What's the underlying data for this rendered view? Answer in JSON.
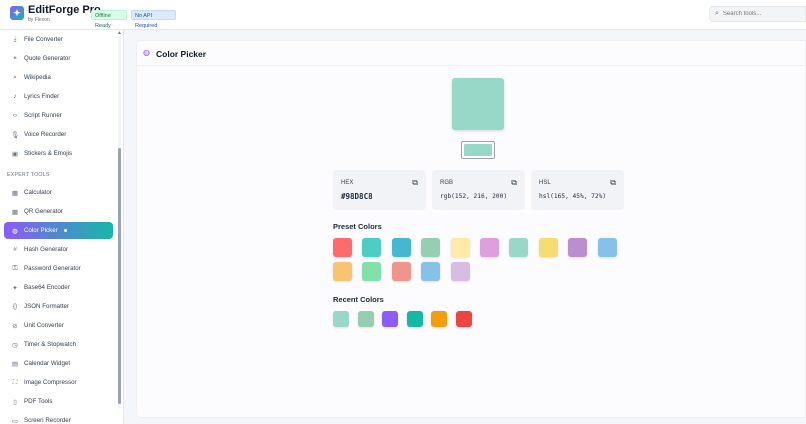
{
  "header": {
    "app_name": "EditForge Pro",
    "app_sub": "by Flexon",
    "badge_offline": "Offline Ready",
    "badge_api": "No API Required",
    "search_placeholder": "Search tools..."
  },
  "sidebar": {
    "items_top": [
      {
        "label": "File Converter",
        "icon": "download-icon",
        "glyph": "⤓"
      },
      {
        "label": "Quote Generator",
        "icon": "quote-icon",
        "glyph": "❝"
      },
      {
        "label": "Wikipedia",
        "icon": "search-icon",
        "glyph": "⌕"
      },
      {
        "label": "Lyrics Finder",
        "icon": "music-icon",
        "glyph": "♪"
      },
      {
        "label": "Script Runner",
        "icon": "code-icon",
        "glyph": "‹›"
      },
      {
        "label": "Voice Recorder",
        "icon": "mic-icon",
        "glyph": "🎙"
      },
      {
        "label": "Stickers & Emojis",
        "icon": "sticker-icon",
        "glyph": "▣"
      }
    ],
    "section_expert": "EXPERT TOOLS",
    "items_expert": [
      {
        "label": "Calculator",
        "icon": "calculator-icon",
        "glyph": "▦"
      },
      {
        "label": "QR Generator",
        "icon": "qr-icon",
        "glyph": "▩"
      },
      {
        "label": "Color Picker",
        "icon": "palette-icon",
        "glyph": "◍",
        "active": true
      },
      {
        "label": "Hash Generator",
        "icon": "hash-icon",
        "glyph": "#"
      },
      {
        "label": "Password Generator",
        "icon": "key-icon",
        "glyph": "⚿"
      },
      {
        "label": "Base64 Encoder",
        "icon": "sparkle-icon",
        "glyph": "✦"
      },
      {
        "label": "JSON Formatter",
        "icon": "braces-icon",
        "glyph": "{}"
      },
      {
        "label": "Unit Converter",
        "icon": "ruler-icon",
        "glyph": "⊘"
      },
      {
        "label": "Timer & Stopwatch",
        "icon": "clock-icon",
        "glyph": "◷"
      },
      {
        "label": "Calendar Widget",
        "icon": "calendar-icon",
        "glyph": "▤"
      },
      {
        "label": "Image Compressor",
        "icon": "compress-icon",
        "glyph": "⛶"
      },
      {
        "label": "PDF Tools",
        "icon": "file-icon",
        "glyph": "▯"
      },
      {
        "label": "Screen Recorder",
        "icon": "monitor-icon",
        "glyph": "▭"
      }
    ]
  },
  "main": {
    "title": "Color Picker",
    "current_color": "#98D8C8",
    "hex_label": "HEX",
    "hex_value": "#98D8C8",
    "rgb_label": "RGB",
    "rgb_value": "rgb(152, 216, 200)",
    "hsl_label": "HSL",
    "hsl_value": "hsl(165, 45%, 72%)",
    "preset_title": "Preset Colors",
    "preset_colors": [
      "#FF6B6B",
      "#4ECDC4",
      "#45B7D1",
      "#96CEB4",
      "#FFEAA7",
      "#DDA0DD",
      "#98D8C8",
      "#F7DC6F",
      "#BB8FCE",
      "#85C1E9",
      "#F8C471",
      "#82E0AA",
      "#F1948A",
      "#85C1E9",
      "#D7BDE2"
    ],
    "recent_title": "Recent Colors",
    "recent_colors": [
      "#98D8C8",
      "#96CEB4",
      "#8B5CF6",
      "#14B8A6",
      "#F59E0B",
      "#EF4444"
    ]
  }
}
